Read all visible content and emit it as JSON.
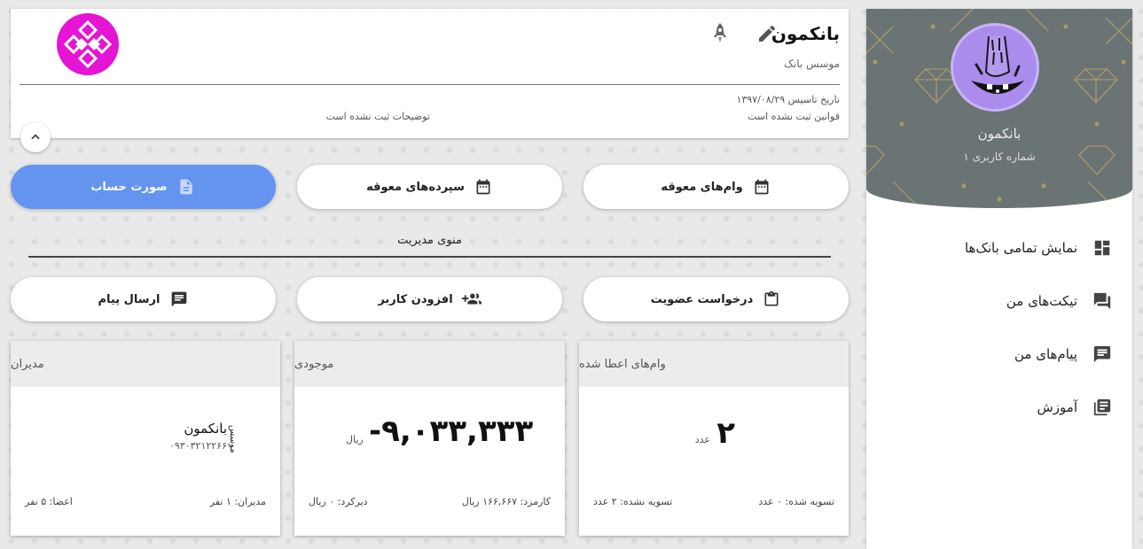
{
  "sidebar": {
    "user_name": "بانکمون",
    "user_number": "شماره کاربری ۱",
    "items": [
      {
        "label": "نمایش تمامی بانک‌ها",
        "icon": "dashboard-icon"
      },
      {
        "label": "تیکت‌های من",
        "icon": "forum-icon"
      },
      {
        "label": "پیام‌های من",
        "icon": "message-icon"
      },
      {
        "label": "آموزش",
        "icon": "library-books-icon"
      }
    ]
  },
  "bank": {
    "title": "بانکمون",
    "founder_label": "موسس بانک",
    "founded": "تاریخ تاسیس ۱۳۹۷/۰۸/۲۹",
    "rules": "قوانین ثبت نشده است",
    "description": "توضیحات ثبت نشده است"
  },
  "actions": {
    "overdue_loans": "وام‌های معوقه",
    "overdue_deposits": "سپرده‌های معوقه",
    "statement": "صورت حساب",
    "admin_menu_title": "منوی مدیریت",
    "membership_request": "درخواست عضویت",
    "add_user": "افزودن کاربر",
    "send_message": "ارسال پیام"
  },
  "cards": {
    "loans": {
      "title": "وام‌های اعطا شده",
      "value": "۲",
      "unit": "عدد",
      "settled": "تسویه شده: ۰ عدد",
      "unsettled": "تسویه نشده: ۲ عدد"
    },
    "balance": {
      "title": "موجودی",
      "value": "-۹,۰۳۳,۳۳۳",
      "unit": "ریال",
      "fee": "کارمزد: ۱۶۶,۶۶۷ ریال",
      "late": "دیرکرد: ۰ ریال"
    },
    "managers": {
      "title": "مدیران",
      "name": "بانکمون",
      "phone": "۰۹۳۰۳۲۱۲۲۶۶",
      "role": "موسس",
      "managers_count": "مدیران: ۱ نفر",
      "members_count": "اعضا: ۵ نفر"
    }
  },
  "colors": {
    "primary": "#6494ef",
    "sidebar_header": "#6b7474",
    "avatar": "#a98cec",
    "logo": "#e614d4"
  }
}
